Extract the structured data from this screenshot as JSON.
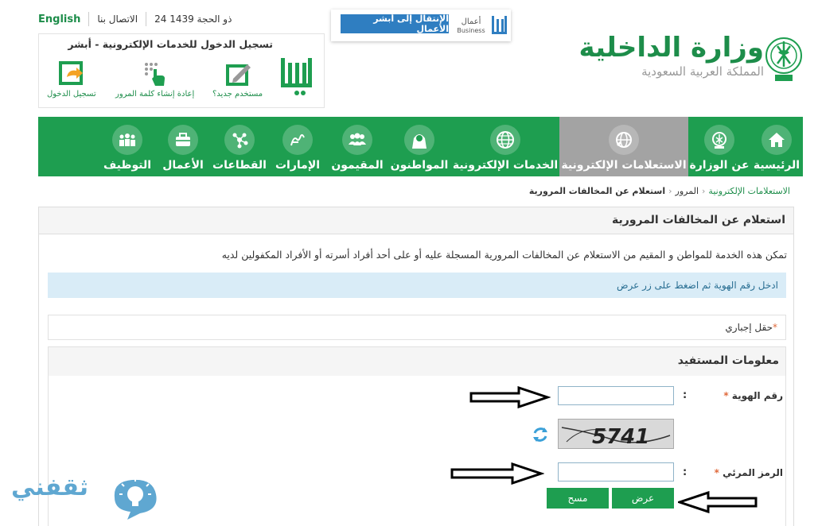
{
  "topbar": {
    "english": "English",
    "contact": "الاتصال بنا",
    "date": "24 ذو الحجة 1439"
  },
  "absher": {
    "title": "تسجيل الدخول للخدمات الإلكترونية - أبشر",
    "logo_icon": "absher-logo",
    "actions": [
      {
        "label": "تسجيل الدخول",
        "icon": "login-arrow-icon"
      },
      {
        "label": "إعادة إنشاء كلمة المرور",
        "icon": "hand-keypad-icon"
      },
      {
        "label": "مستخدم جديد؟",
        "icon": "pen-signup-icon"
      }
    ]
  },
  "business": {
    "button": "الإنتقال إلى أبشر الأعمال",
    "logo_ar": "أعمال",
    "logo_en": "Business"
  },
  "ministry": {
    "name": "وزارة الداخلية",
    "kingdom": "المملكة العربية السعودية",
    "emblem_icon": "saudi-emblem-icon"
  },
  "nav": [
    {
      "label": "الرئيسية",
      "icon": "home-icon",
      "active": false
    },
    {
      "label": "عن الوزارة",
      "icon": "ministry-icon",
      "active": false
    },
    {
      "label": "الاستعلامات الإلكترونية",
      "icon": "globe-search-icon",
      "active": true
    },
    {
      "label": "الخدمات الإلكترونية",
      "icon": "globe-icon",
      "active": false
    },
    {
      "label": "المواطنون",
      "icon": "citizen-icon",
      "active": false
    },
    {
      "label": "المقيمون",
      "icon": "residents-icon",
      "active": false
    },
    {
      "label": "الإمارات",
      "icon": "emirates-icon",
      "active": false
    },
    {
      "label": "القطاعات",
      "icon": "sectors-icon",
      "active": false
    },
    {
      "label": "الأعمال",
      "icon": "briefcase-icon",
      "active": false
    },
    {
      "label": "التوظيف",
      "icon": "employment-icon",
      "active": false
    }
  ],
  "breadcrumb": {
    "level1": "الاستعلامات الإلكترونية",
    "level2": "المرور",
    "level3": "استعلام عن المخالفات المرورية"
  },
  "page": {
    "title": "استعلام عن المخالفات المرورية",
    "intro": "تمكن هذه الخدمة للمواطن و المقيم من الاستعلام عن المخالفات المرورية المسجلة عليه أو على أحد أفراد أسرته أو الأفراد المكفولين لديه",
    "info": "ادخل رقم الهوية ثم اضغط على زر عرض",
    "required_note": "حقل إجباري",
    "required_star": "*"
  },
  "form": {
    "section_title": "معلومات المستفيد",
    "id_label": "رقم الهوية",
    "id_value": "",
    "captcha_label": "الرمز المرئي",
    "captcha_value": "",
    "captcha_text": "5741",
    "colon": ":",
    "star": "*",
    "show_button": "عرض",
    "clear_button": "مسح"
  },
  "watermark": {
    "text": "ثقفني",
    "icon": "lightbulb-icon"
  },
  "colors": {
    "brand_green": "#1e9e50",
    "active_gray": "#a3a3a3",
    "info_bg": "#d9ecf7",
    "link_blue": "#2f7ec1"
  }
}
